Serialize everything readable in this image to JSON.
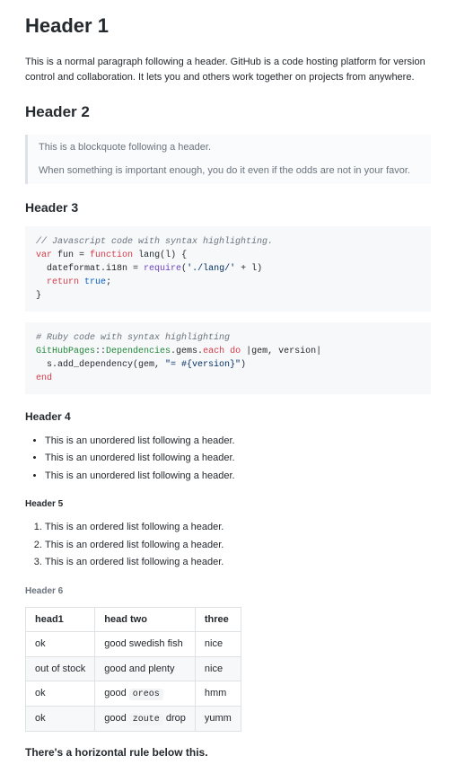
{
  "h1": "Header 1",
  "intro": "This is a normal paragraph following a header. GitHub is a code hosting platform for version control and collaboration. It lets you and others work together on projects from anywhere.",
  "h2": "Header 2",
  "blockquote": {
    "line1": "This is a blockquote following a header.",
    "line2": "When something is important enough, you do it even if the odds are not in your favor."
  },
  "h3": "Header 3",
  "js_code": {
    "comment": "// Javascript code with syntax highlighting.",
    "l1_var": "var",
    "l1_name": " fun ",
    "l1_eq": "= ",
    "l1_fn": "function",
    "l1_rest": " lang(l) {",
    "l2_a": "  dateformat.i18n = ",
    "l2_req": "require",
    "l2_b": "(",
    "l2_str": "'./lang/'",
    "l2_c": " + l)",
    "l3_a": "  ",
    "l3_ret": "return",
    "l3_b": " ",
    "l3_true": "true",
    "l3_c": ";",
    "l4": "}"
  },
  "rb_code": {
    "comment": "# Ruby code with syntax highlighting",
    "l1_a": "GitHubPages",
    "l1_b": "::",
    "l1_c": "Dependencies",
    "l1_d": ".gems.",
    "l1_each": "each",
    "l1_e": " ",
    "l1_do": "do",
    "l1_f": " |gem, version|",
    "l2_a": "  s.add_dependency(gem, ",
    "l2_str": "\"= #{version}\"",
    "l2_b": ")",
    "l3": "end"
  },
  "h4": "Header 4",
  "ul": [
    "This is an unordered list following a header.",
    "This is an unordered list following a header.",
    "This is an unordered list following a header."
  ],
  "h5": "Header 5",
  "ol": [
    "This is an ordered list following a header.",
    "This is an ordered list following a header.",
    "This is an ordered list following a header."
  ],
  "h6": "Header 6",
  "table": {
    "headers": [
      "head1",
      "head two",
      "three"
    ],
    "rows": [
      [
        "ok",
        "good swedish fish",
        "nice"
      ],
      [
        "out of stock",
        "good and plenty",
        "nice"
      ],
      [
        "ok",
        {
          "pre": "good ",
          "code": "oreos"
        },
        "hmm"
      ],
      [
        "ok",
        {
          "pre": "good ",
          "code": "zoute",
          "post": " drop"
        },
        "yumm"
      ]
    ]
  },
  "hr_text": "There's a horizontal rule below this."
}
